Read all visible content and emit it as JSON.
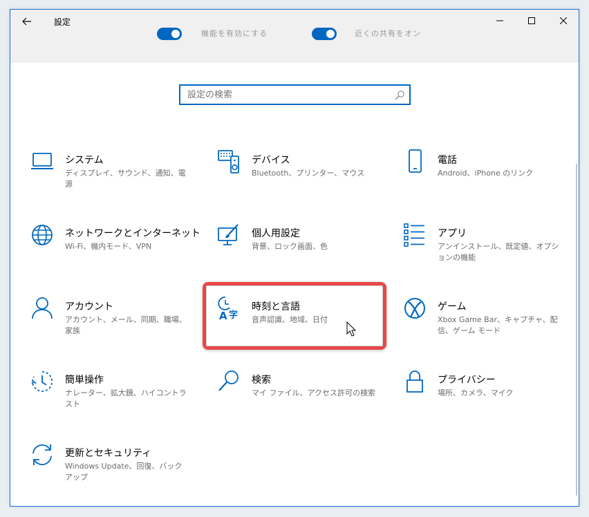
{
  "window": {
    "title": "設定",
    "accent": "#0067c0",
    "controls": {
      "minimize": "minimize-icon",
      "maximize": "maximize-icon",
      "close": "close-icon"
    }
  },
  "top_toggles": [
    {
      "label": "機能を有効にする",
      "state": "on"
    },
    {
      "label": "近くの共有をオン",
      "state": "on"
    }
  ],
  "search": {
    "placeholder": "設定の検索",
    "value": ""
  },
  "tiles": [
    {
      "id": "system",
      "icon": "laptop-icon",
      "title": "システム",
      "desc": "ディスプレイ、サウンド、通知、電源"
    },
    {
      "id": "devices",
      "icon": "keyboard-speaker-icon",
      "title": "デバイス",
      "desc": "Bluetooth、プリンター、マウス"
    },
    {
      "id": "phone",
      "icon": "phone-icon",
      "title": "電話",
      "desc": "Android、iPhone のリンク"
    },
    {
      "id": "network",
      "icon": "globe-icon",
      "title": "ネットワークとインターネット",
      "desc": "Wi-Fi、機内モード、VPN"
    },
    {
      "id": "personalization",
      "icon": "paintbrush-icon",
      "title": "個人用設定",
      "desc": "背景、ロック画面、色"
    },
    {
      "id": "apps",
      "icon": "app-list-icon",
      "title": "アプリ",
      "desc": "アンインストール、既定値、オプションの機能"
    },
    {
      "id": "accounts",
      "icon": "person-icon",
      "title": "アカウント",
      "desc": "アカウント、メール、同期、職場、家族"
    },
    {
      "id": "time-language",
      "icon": "time-language-icon",
      "title": "時刻と言語",
      "desc": "音声認識、地域、日付"
    },
    {
      "id": "gaming",
      "icon": "xbox-icon",
      "title": "ゲーム",
      "desc": "Xbox Game Bar、キャプチャ、配信、ゲーム モード"
    },
    {
      "id": "ease-of-access",
      "icon": "ease-of-access-icon",
      "title": "簡単操作",
      "desc": "ナレーター、拡大鏡、ハイコントラスト"
    },
    {
      "id": "search",
      "icon": "magnifier-icon",
      "title": "検索",
      "desc": "マイ ファイル、アクセス許可の検索"
    },
    {
      "id": "privacy",
      "icon": "lock-icon",
      "title": "プライバシー",
      "desc": "場所、カメラ、マイク"
    },
    {
      "id": "update-security",
      "icon": "sync-arrows-icon",
      "title": "更新とセキュリティ",
      "desc": "Windows Update、回復、バックアップ"
    }
  ],
  "highlight": {
    "target": "time-language",
    "color": "#e84747"
  }
}
